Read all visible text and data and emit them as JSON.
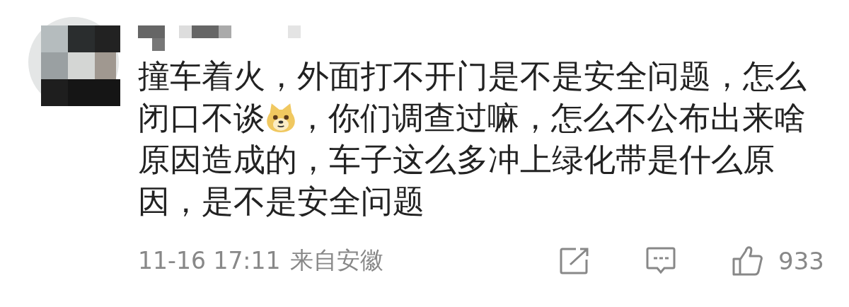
{
  "comment": {
    "content": [
      {
        "kind": "text",
        "text": "撞车着火，外面打不开门是不是安全问题，怎么闭口不谈"
      },
      {
        "kind": "emoji"
      },
      {
        "kind": "text",
        "text": "，你们调查过嘛，怎么不公布出来啥原因造成的，车子这么多冲上绿化带是什么原因，是不是安全问题"
      }
    ],
    "time": "11-16 17:11",
    "location": "来自安徽",
    "likes": "933"
  }
}
